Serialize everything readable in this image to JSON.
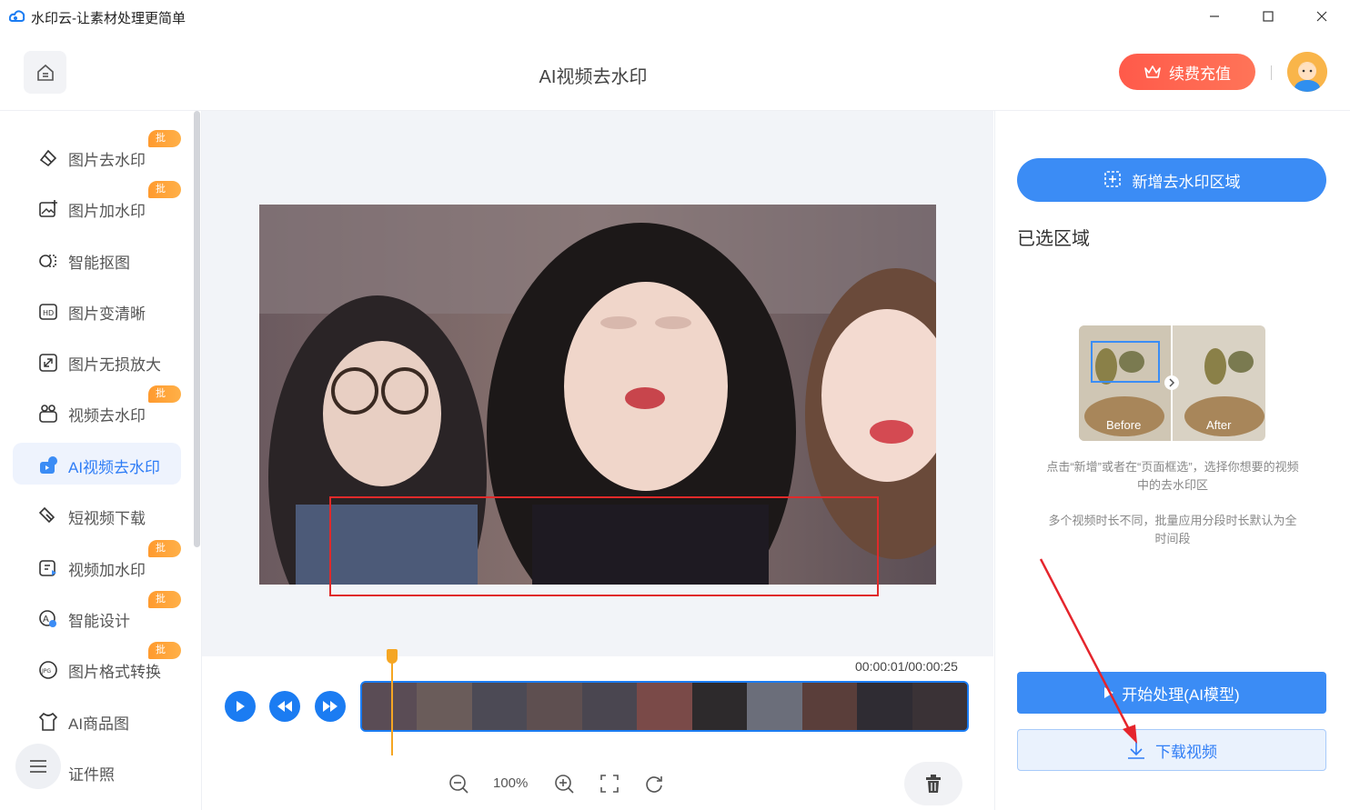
{
  "titlebar": {
    "title": "水印云-让素材处理更简单"
  },
  "header": {
    "page_title": "AI视频去水印",
    "vip_label": "续费充值"
  },
  "sidebar": {
    "items": [
      {
        "label": "图片去水印",
        "badge": "批量",
        "icon": "eraser-icon"
      },
      {
        "label": "图片加水印",
        "badge": "批量",
        "icon": "image-add-icon"
      },
      {
        "label": "智能抠图",
        "badge": "",
        "icon": "cutout-icon"
      },
      {
        "label": "图片变清晰",
        "badge": "",
        "icon": "hd-icon"
      },
      {
        "label": "图片无损放大",
        "badge": "",
        "icon": "enlarge-icon"
      },
      {
        "label": "视频去水印",
        "badge": "批量",
        "icon": "video-clean-icon"
      },
      {
        "label": "AI视频去水印",
        "badge": "",
        "icon": "ai-video-icon"
      },
      {
        "label": "短视频下载",
        "badge": "",
        "icon": "download-link-icon"
      },
      {
        "label": "视频加水印",
        "badge": "批量",
        "icon": "video-add-icon"
      },
      {
        "label": "智能设计",
        "badge": "批量",
        "icon": "design-icon"
      },
      {
        "label": "图片格式转换",
        "badge": "批量",
        "icon": "jpg-icon"
      },
      {
        "label": "AI商品图",
        "badge": "",
        "icon": "tshirt-icon"
      },
      {
        "label": "证件照",
        "badge": "",
        "icon": "idphoto-icon"
      }
    ],
    "active_index": 6
  },
  "timeline": {
    "time": "00:00:01/00:00:25",
    "zoom": "100%",
    "playhead_fraction": 0.04
  },
  "right_panel": {
    "add_region_label": "新增去水印区域",
    "selected_heading": "已选区域",
    "demo_before": "Before",
    "demo_after": "After",
    "hint1": "点击“新增”或者在“页面框选”，选择你想要的视频中的去水印区",
    "hint2": "多个视频时长不同，批量应用分段时长默认为全时间段",
    "start_label": "开始处理(AI模型)",
    "download_label": "下载视频"
  },
  "colors": {
    "accent": "#3b8cf5",
    "badge": "#ff9a2e",
    "vip": "#ff5a4a",
    "selection": "#e02a2a",
    "playhead": "#f5a623"
  }
}
